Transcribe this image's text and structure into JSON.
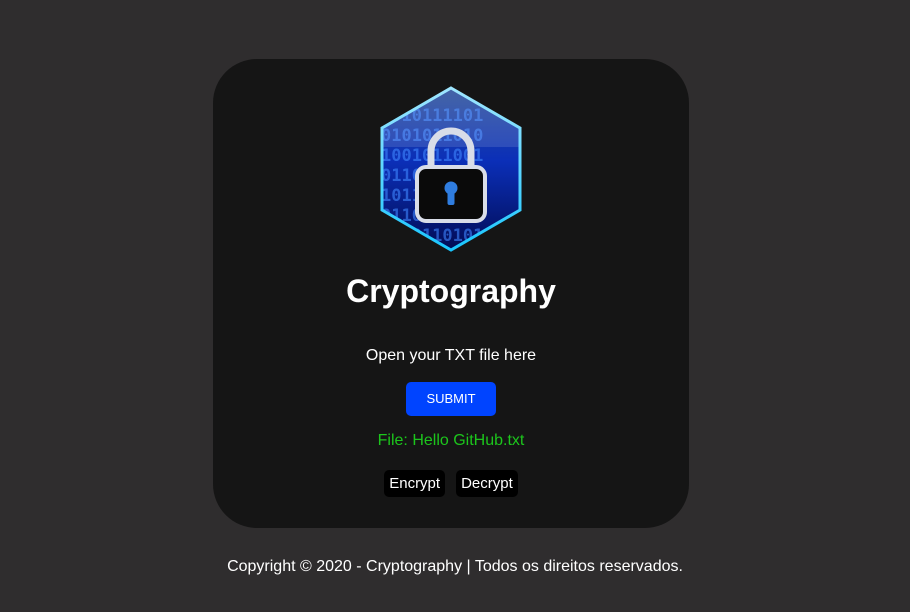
{
  "card": {
    "title": "Cryptography",
    "open_file_label": "Open your TXT file here",
    "submit_label": "SUBMIT",
    "file_status": "File: Hello GitHub.txt",
    "encrypt_label": "Encrypt",
    "decrypt_label": "Decrypt"
  },
  "logo": {
    "icon": "padlock-binary-hexagon-icon",
    "binary_rows": [
      "1010111101",
      "0101011010",
      "1001011001",
      "0110101101",
      "1011001010",
      "0110001110",
      "1010110101"
    ]
  },
  "footer": {
    "copyright": "Copyright © 2020 - Cryptography | Todos os direitos reservados."
  },
  "colors": {
    "page_background": "#2f2d2e",
    "card_background": "#151515",
    "submit_button": "#0044ff",
    "file_status_text": "#1cc51c",
    "action_button": "#000000"
  }
}
